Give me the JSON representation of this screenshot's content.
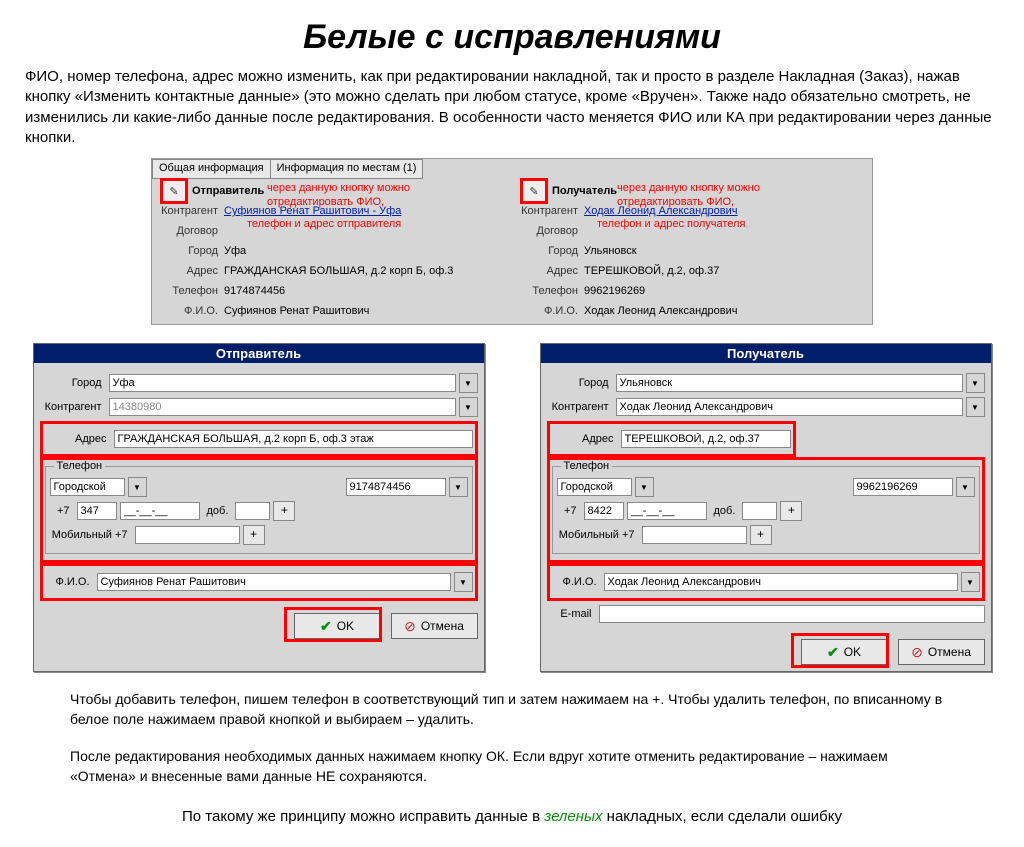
{
  "title": "Белые с исправлениями",
  "intro": "ФИО, номер телефона, адрес можно изменить, как при редактировании накладной, так и просто в разделе Накладная (Заказ), нажав кнопку «Изменить контактные данные» (это можно сделать при любом статусе, кроме «Вручен». Также надо обязательно смотреть, не изменились ли какие-либо данные после редактирования. В особенности часто меняется ФИО или КА при редактировании через данные кнопки.",
  "info": {
    "tab1": "Общая информация",
    "tab2": "Информация по местам (1)",
    "labels": {
      "sender": "Отправитель",
      "receiver": "Получатель",
      "contragent": "Контрагент",
      "contract": "Договор",
      "city": "Город",
      "address": "Адрес",
      "phone": "Телефон",
      "fio": "Ф.И.О."
    },
    "sender": {
      "contragent": "Суфиянов Ренат Рашитович - Уфа",
      "city": "Уфа",
      "address": "ГРАЖДАНСКАЯ БОЛЬШАЯ, д.2 корп Б, оф.3",
      "phone": "9174874456",
      "fio": "Суфиянов Ренат Рашитович"
    },
    "receiver": {
      "contragent": "Ходак Леонид Александрович",
      "city": "Ульяновск",
      "address": "ТЕРЕШКОВОЙ, д.2, оф.37",
      "phone": "9962196269",
      "fio": "Ходак Леонид Александрович"
    },
    "note_button": "через данную кнопку можно отредактировать ФИО,",
    "note_sender": "телефон и адрес отправителя",
    "note_receiver": "телефон и адрес получателя"
  },
  "dlg": {
    "sender_title": "Отправитель",
    "receiver_title": "Получатель",
    "labels": {
      "city": "Город",
      "contragent": "Контрагент",
      "address": "Адрес",
      "phone": "Телефон",
      "phone_type": "Городской",
      "plus7": "+7",
      "mobile": "Мобильный +7",
      "ext": "доб.",
      "fio": "Ф.И.О.",
      "email": "E-mail"
    },
    "sender": {
      "city": "Уфа",
      "contragent": "14380980",
      "address": "ГРАЖДАНСКАЯ БОЛЬШАЯ, д.2 корп Б, оф.3 этаж",
      "area": "347",
      "phone_list": "9174874456",
      "fio": "Суфиянов Ренат Рашитович"
    },
    "receiver": {
      "city": "Ульяновск",
      "contragent": "Ходак Леонид Александрович",
      "address": "ТЕРЕШКОВОЙ, д.2, оф.37",
      "area": "8422",
      "phone_list": "9962196269",
      "fio": "Ходак Леонид Александрович"
    },
    "ok": "OK",
    "cancel": "Отмена"
  },
  "footer1": "Чтобы добавить телефон, пишем телефон в соответствующий тип и затем нажимаем на +. Чтобы удалить телефон, по вписанному в белое поле нажимаем правой кнопкой и выбираем – удалить.",
  "footer2": "После редактирования необходимых данных нажимаем кнопку ОК. Если вдруг хотите отменить редактирование – нажимаем «Отмена» и внесенные вами данные НЕ сохраняются.",
  "bottom": "По такому же принципу можно исправить данные в ",
  "bottom_green": "зеленых",
  "bottom_tail": " накладных, если сделали ошибку"
}
